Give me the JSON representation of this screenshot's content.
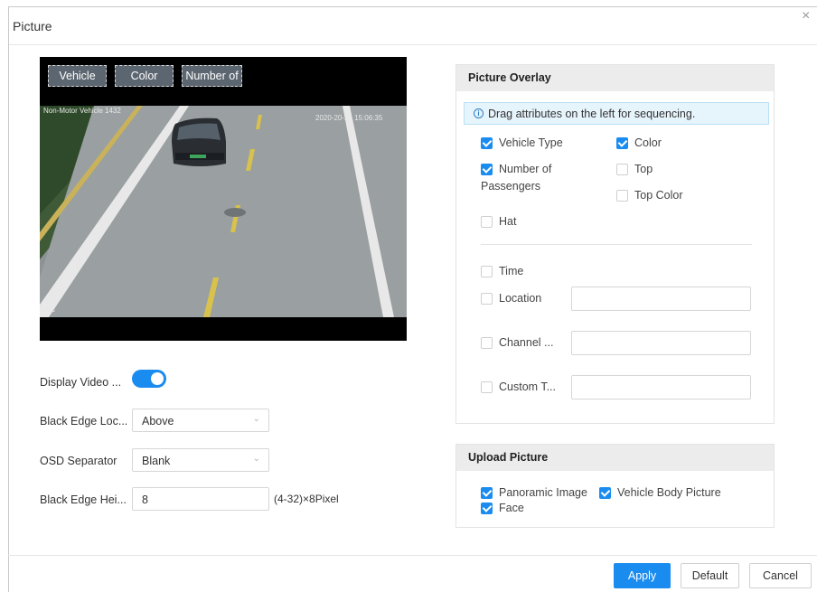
{
  "dialog": {
    "title": "Picture",
    "close_glyph": "×"
  },
  "preview": {
    "osd_items": [
      "Vehicle",
      "Color",
      "Number of"
    ],
    "overlay_text": {
      "top_left": "Non-Motor Vehicle  1432",
      "timestamp": "2020-20-21 15:06:35",
      "bottom_left": "IPC"
    }
  },
  "form": {
    "display_video_label": "Display Video ...",
    "display_video_on": true,
    "black_edge_location_label": "Black Edge Loc...",
    "black_edge_location_value": "Above",
    "osd_separator_label": "OSD Separator",
    "osd_separator_value": "Blank",
    "black_edge_height_label": "Black Edge Hei...",
    "black_edge_height_value": "8",
    "black_edge_height_unit": "(4-32)×8Pixel"
  },
  "picture_overlay": {
    "title": "Picture Overlay",
    "info": "Drag attributes on the left for sequencing.",
    "items": [
      {
        "label": "Vehicle Type",
        "checked": true
      },
      {
        "label": "Color",
        "checked": true
      },
      {
        "label": "Number of\nPassengers",
        "checked": true
      },
      {
        "label": "Top",
        "checked": false
      },
      {
        "label": "Top Color",
        "checked": false
      },
      {
        "label": "Hat",
        "checked": false
      },
      {
        "label": "Time",
        "checked": false
      },
      {
        "label": "Location",
        "checked": false
      },
      {
        "label": "Channel ...",
        "checked": false
      },
      {
        "label": "Custom T...",
        "checked": false
      }
    ]
  },
  "upload_picture": {
    "title": "Upload Picture",
    "items": [
      {
        "label": "Panoramic Image",
        "checked": true
      },
      {
        "label": "Vehicle Body Picture",
        "checked": true
      },
      {
        "label": "Face",
        "checked": true
      }
    ]
  },
  "footer": {
    "apply": "Apply",
    "default": "Default",
    "cancel": "Cancel"
  },
  "colors": {
    "accent": "#1a8cf0",
    "panel_header": "#ececec",
    "info_bg": "#e6f4fc"
  },
  "icons": {
    "close": "close-icon",
    "info": "info-icon",
    "chevron": "chevron-down-icon",
    "check": "check-icon"
  }
}
